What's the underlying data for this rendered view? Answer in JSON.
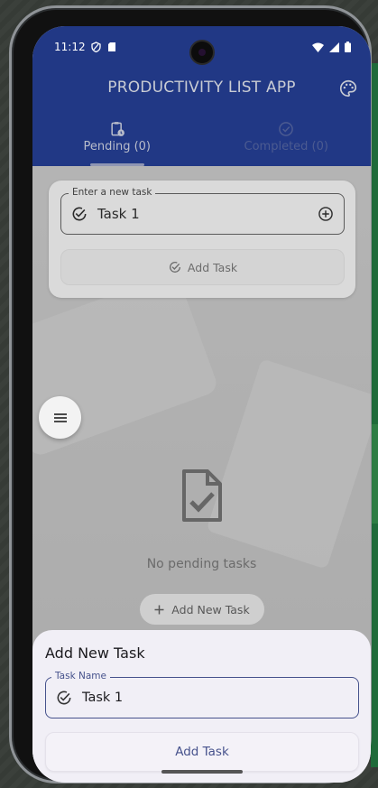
{
  "status_bar": {
    "time": "11:12"
  },
  "app": {
    "title": "PRODUCTIVITY LIST APP"
  },
  "tabs": [
    {
      "label": "Pending (0)",
      "selected": true
    },
    {
      "label": "Completed (0)",
      "selected": false
    }
  ],
  "task_card": {
    "field_label": "Enter a new task",
    "field_value": "Task 1",
    "button_label": "Add Task"
  },
  "empty_state": {
    "text": "No pending tasks",
    "button_label": "Add New Task"
  },
  "sheet": {
    "title": "Add New Task",
    "field_label": "Task Name",
    "field_value": "Task 1",
    "button_label": "Add Task"
  },
  "colors": {
    "app_bar": "#213885",
    "accent": "#46528c",
    "sheet_bg": "#f1eff6"
  },
  "icons": [
    "shield-icon",
    "sim-icon",
    "wifi-icon",
    "signal-icon",
    "battery-icon",
    "palette-icon",
    "clipboard-clock-icon",
    "check-circle-icon",
    "task-check-icon",
    "add-circle-icon",
    "menu-icon",
    "document-check-icon",
    "plus-icon"
  ]
}
